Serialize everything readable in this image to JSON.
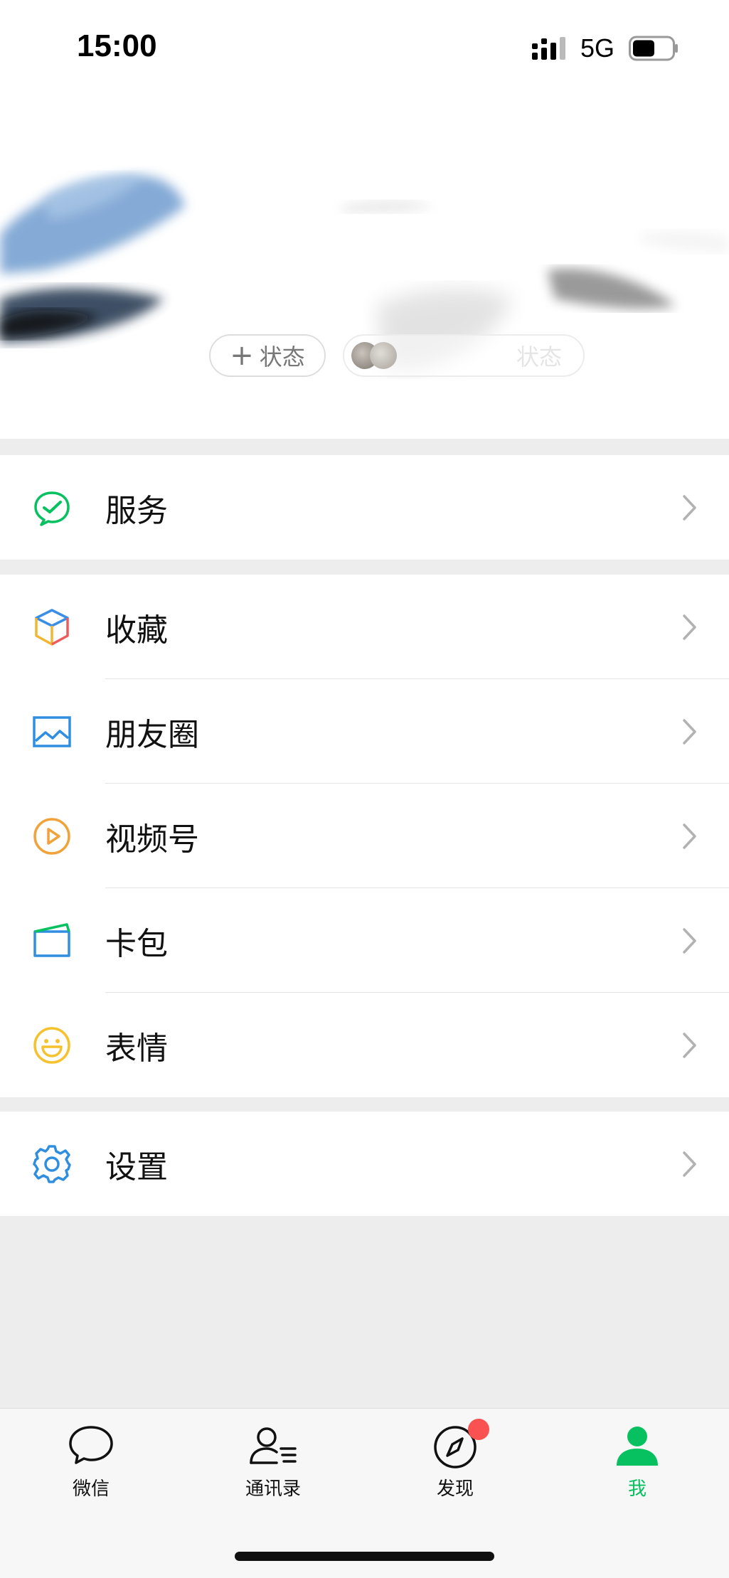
{
  "status_bar": {
    "time": "15:00",
    "network": "5G",
    "battery_percent": 55
  },
  "profile": {
    "status_button_plus": "+",
    "status_button_label": "状态",
    "friends_status_label": "状态"
  },
  "menu": {
    "services": "服务",
    "favorites": "收藏",
    "moments": "朋友圈",
    "channels": "视频号",
    "cards": "卡包",
    "stickers": "表情",
    "settings": "设置"
  },
  "tabs": {
    "chats": "微信",
    "contacts": "通讯录",
    "discover": "发现",
    "me": "我"
  },
  "colors": {
    "accent_green": "#07c160",
    "badge_red": "#fa5151",
    "page_bg": "#ededed"
  }
}
